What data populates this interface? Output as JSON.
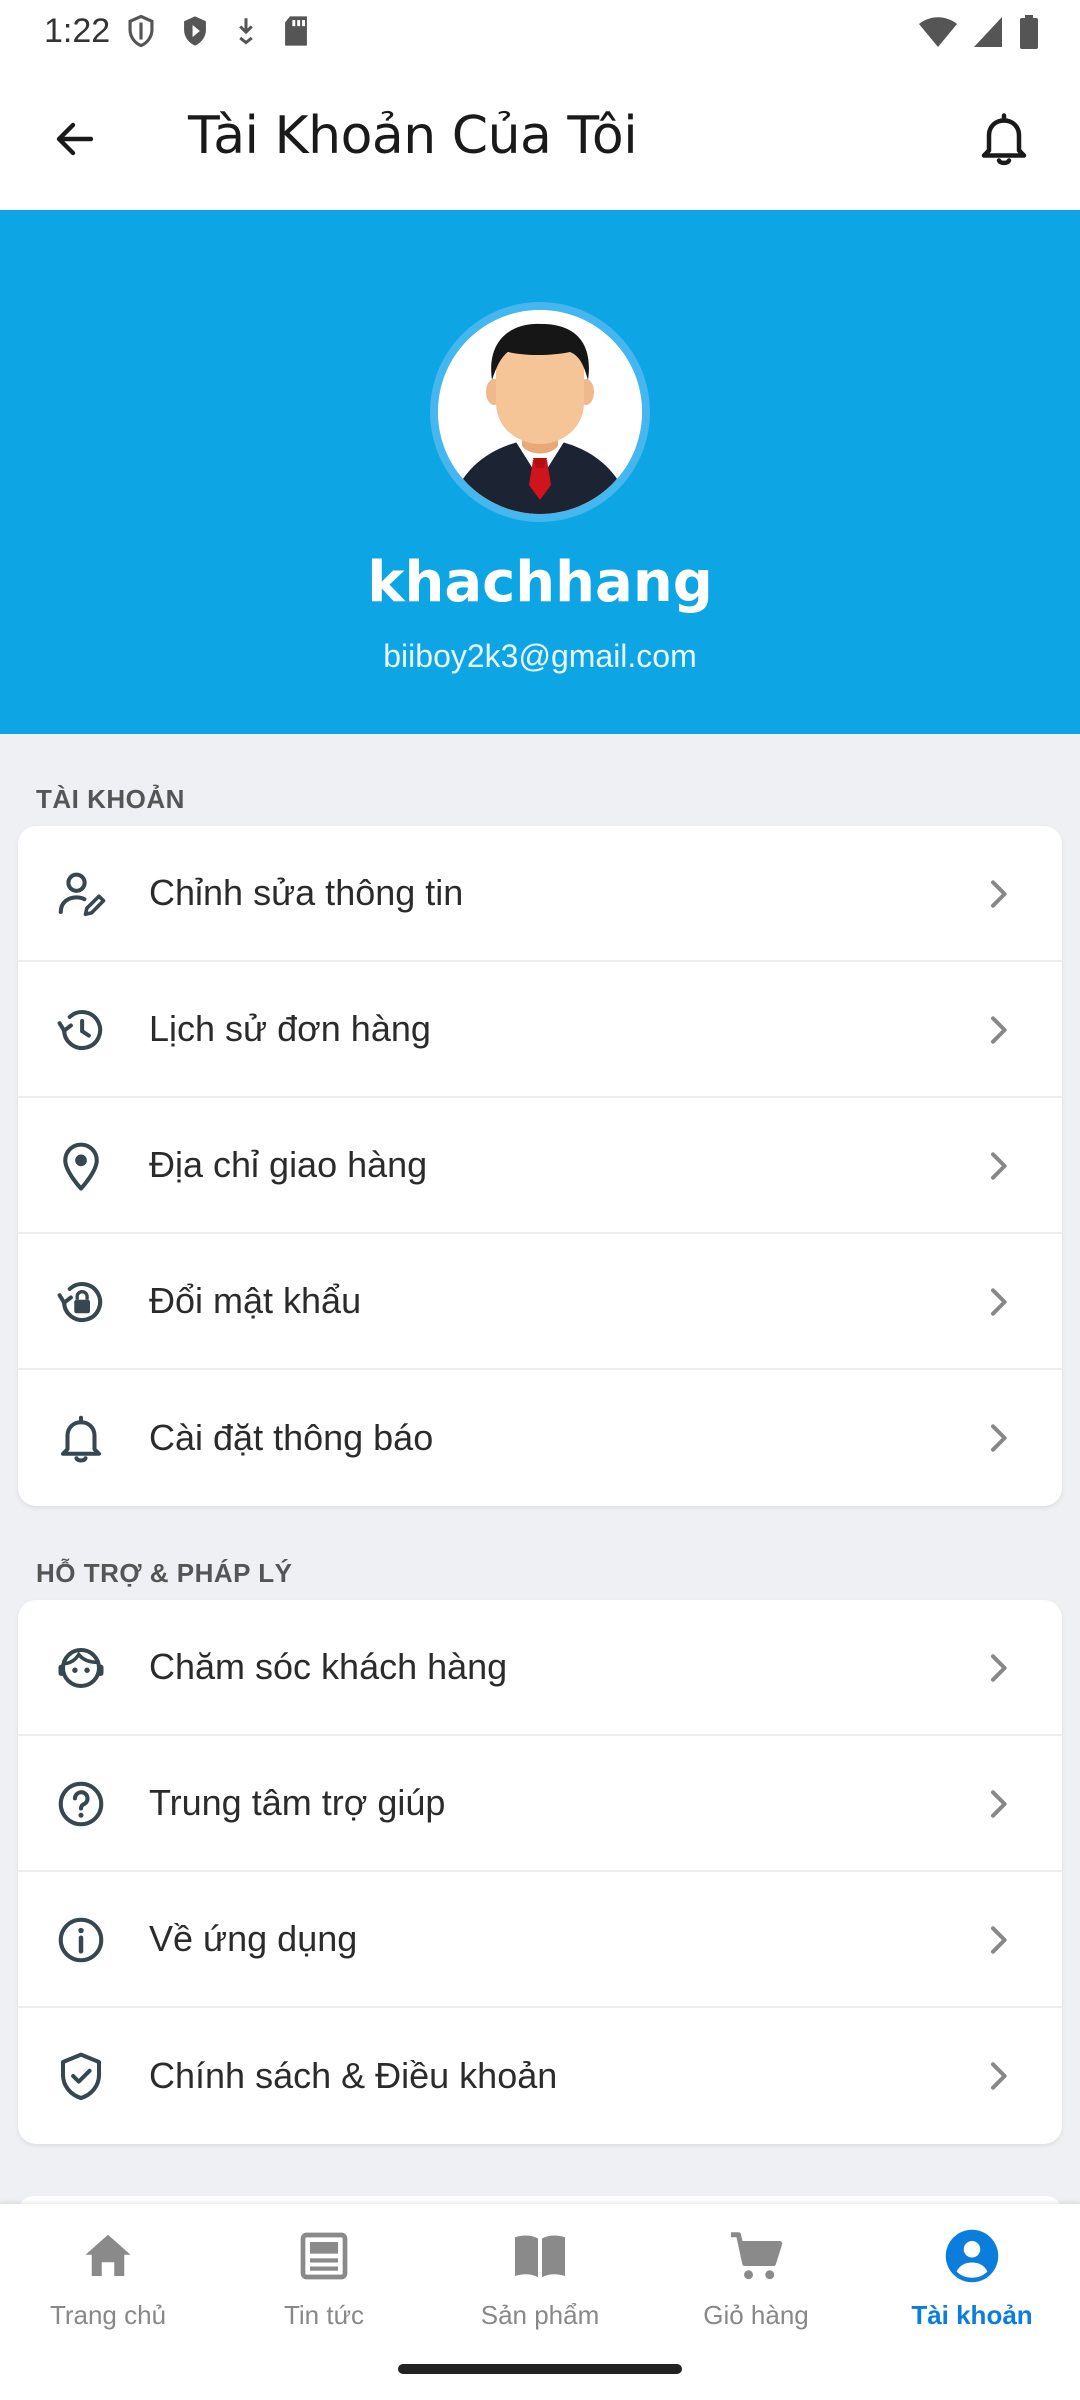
{
  "status_bar": {
    "time": "1:22"
  },
  "header": {
    "title": "Tài Khoản Của Tôi"
  },
  "profile": {
    "username": "khachhang",
    "email": "biiboy2k3@gmail.com"
  },
  "sections": {
    "account": {
      "title": "TÀI KHOẢN",
      "items": [
        {
          "label": "Chỉnh sửa thông tin",
          "icon": "edit-user-icon"
        },
        {
          "label": "Lịch sử đơn hàng",
          "icon": "history-icon"
        },
        {
          "label": "Địa chỉ giao hàng",
          "icon": "location-pin-icon"
        },
        {
          "label": "Đổi mật khẩu",
          "icon": "lock-reset-icon"
        },
        {
          "label": "Cài đặt thông báo",
          "icon": "bell-icon"
        }
      ]
    },
    "support": {
      "title": "HỖ TRỢ & PHÁP LÝ",
      "items": [
        {
          "label": "Chăm sóc khách hàng",
          "icon": "support-agent-icon"
        },
        {
          "label": "Trung tâm trợ giúp",
          "icon": "help-circle-icon"
        },
        {
          "label": "Về ứng dụng",
          "icon": "info-icon"
        },
        {
          "label": "Chính sách & Điều khoản",
          "icon": "shield-check-icon"
        }
      ]
    }
  },
  "bottom_nav": {
    "items": [
      {
        "label": "Trang chủ",
        "icon": "home-icon"
      },
      {
        "label": "Tin tức",
        "icon": "news-icon"
      },
      {
        "label": "Sản phẩm",
        "icon": "book-icon"
      },
      {
        "label": "Giỏ hàng",
        "icon": "cart-icon"
      },
      {
        "label": "Tài khoản",
        "icon": "account-icon",
        "active": true
      }
    ]
  },
  "colors": {
    "primary": "#0ea5e4",
    "active_nav": "#0b7ddc",
    "icon": "#37474f"
  }
}
